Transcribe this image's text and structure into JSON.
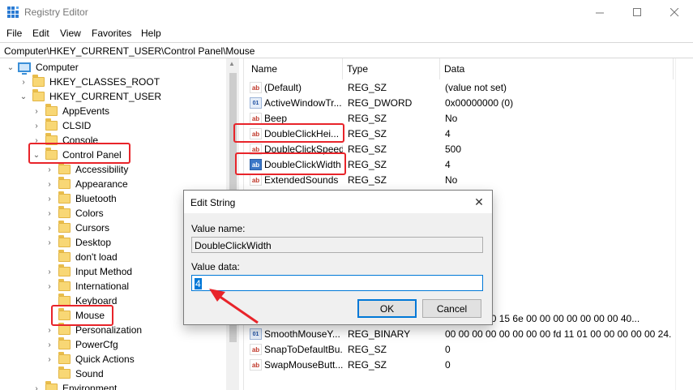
{
  "window": {
    "title": "Registry Editor"
  },
  "menu": [
    "File",
    "Edit",
    "View",
    "Favorites",
    "Help"
  ],
  "address": "Computer\\HKEY_CURRENT_USER\\Control Panel\\Mouse",
  "tree": {
    "computer": "Computer",
    "items": [
      "HKEY_CLASSES_ROOT",
      "HKEY_CURRENT_USER",
      "AppEvents",
      "CLSID",
      "Console",
      "Control Panel",
      "Accessibility",
      "Appearance",
      "Bluetooth",
      "Colors",
      "Cursors",
      "Desktop",
      "don't load",
      "Input Method",
      "International",
      "Keyboard",
      "Mouse",
      "Personalization",
      "PowerCfg",
      "Quick Actions",
      "Sound",
      "Environment"
    ]
  },
  "values": {
    "headers": {
      "name": "Name",
      "type": "Type",
      "data": "Data"
    },
    "rows": [
      {
        "name": "(Default)",
        "type": "REG_SZ",
        "data": "(value not set)",
        "icon": "string-value-icon"
      },
      {
        "name": "ActiveWindowTr...",
        "type": "REG_DWORD",
        "data": "0x00000000 (0)",
        "icon": "binary-value-icon"
      },
      {
        "name": "Beep",
        "type": "REG_SZ",
        "data": "No",
        "icon": "string-value-icon"
      },
      {
        "name": "DoubleClickHei...",
        "type": "REG_SZ",
        "data": "4",
        "icon": "string-value-icon"
      },
      {
        "name": "DoubleClickSpeed",
        "type": "REG_SZ",
        "data": "500",
        "icon": "string-value-icon"
      },
      {
        "name": "DoubleClickWidth",
        "type": "REG_SZ",
        "data": "4",
        "icon": "string-value-icon"
      },
      {
        "name": "ExtendedSounds",
        "type": "REG_SZ",
        "data": "No",
        "icon": "string-value-icon"
      },
      {
        "name": "",
        "type": "",
        "data": "00 00 00 00 15 6e 00 00 00 00 00 00 00 40...",
        "icon": "binary-value-icon"
      },
      {
        "name": "SmoothMouseY...",
        "type": "REG_BINARY",
        "data": "00 00 00 00 00 00 00 00 fd 11 01 00 00 00 00 00 24...",
        "icon": "binary-value-icon"
      },
      {
        "name": "SnapToDefaultBu...",
        "type": "REG_SZ",
        "data": "0",
        "icon": "string-value-icon"
      },
      {
        "name": "SwapMouseButt...",
        "type": "REG_SZ",
        "data": "0",
        "icon": "string-value-icon"
      }
    ]
  },
  "dialog": {
    "title": "Edit String",
    "value_name_label": "Value name:",
    "value_name": "DoubleClickWidth",
    "value_data_label": "Value data:",
    "value_data": "4",
    "ok": "OK",
    "cancel": "Cancel"
  },
  "colors": {
    "highlight": "#e8242a",
    "accent": "#0078d7"
  }
}
